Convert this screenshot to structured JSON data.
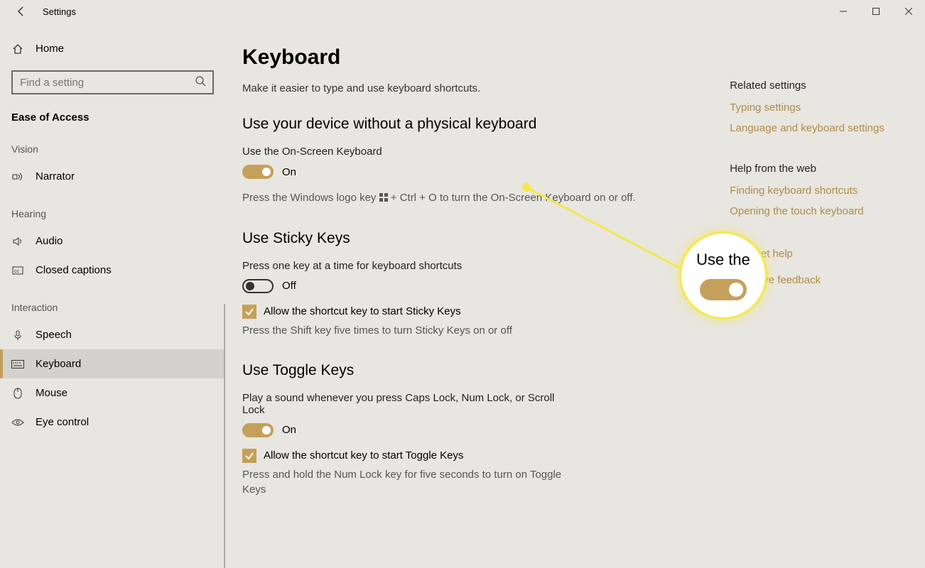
{
  "window": {
    "title": "Settings"
  },
  "sidebar": {
    "home": "Home",
    "search_placeholder": "Find a setting",
    "category": "Ease of Access",
    "groups": {
      "vision": {
        "label": "Vision",
        "items": [
          {
            "label": "Narrator"
          }
        ]
      },
      "hearing": {
        "label": "Hearing",
        "items": [
          {
            "label": "Audio"
          },
          {
            "label": "Closed captions"
          }
        ]
      },
      "interaction": {
        "label": "Interaction",
        "items": [
          {
            "label": "Speech"
          },
          {
            "label": "Keyboard"
          },
          {
            "label": "Mouse"
          },
          {
            "label": "Eye control"
          }
        ]
      }
    }
  },
  "main": {
    "title": "Keyboard",
    "subtitle": "Make it easier to type and use keyboard shortcuts.",
    "osk": {
      "heading": "Use your device without a physical keyboard",
      "label": "Use the On-Screen Keyboard",
      "state": "On",
      "hint_pre": "Press the Windows logo key ",
      "hint_post": " + Ctrl + O to turn the On-Screen Keyboard on or off."
    },
    "sticky": {
      "heading": "Use Sticky Keys",
      "label": "Press one key at a time for keyboard shortcuts",
      "state": "Off",
      "check_label": "Allow the shortcut key to start Sticky Keys",
      "hint": "Press the Shift key five times to turn Sticky Keys on or off"
    },
    "toggle_keys": {
      "heading": "Use Toggle Keys",
      "label": "Play a sound whenever you press Caps Lock, Num Lock, or Scroll Lock",
      "state": "On",
      "check_label": "Allow the shortcut key to start Toggle Keys",
      "hint": "Press and hold the Num Lock key for five seconds to turn on Toggle Keys"
    }
  },
  "aside": {
    "related_heading": "Related settings",
    "related": [
      {
        "label": "Typing settings"
      },
      {
        "label": "Language and keyboard settings"
      }
    ],
    "web_heading": "Help from the web",
    "web": [
      {
        "label": "Finding keyboard shortcuts"
      },
      {
        "label": "Opening the touch keyboard"
      }
    ],
    "help": "Get help",
    "feedback": "Give feedback"
  },
  "callout": {
    "text": "Use the"
  }
}
